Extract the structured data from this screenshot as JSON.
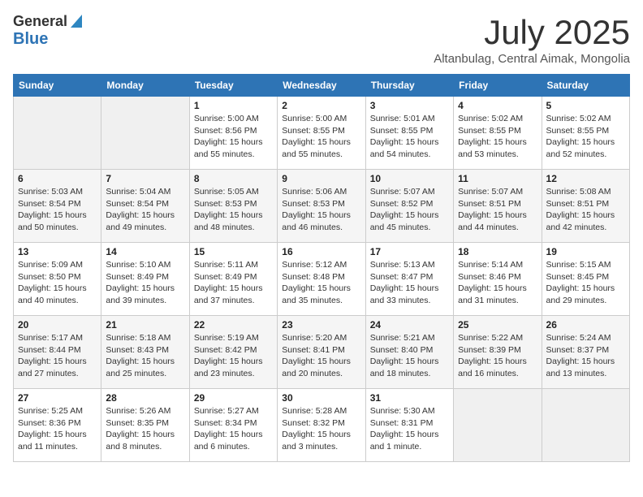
{
  "header": {
    "logo_general": "General",
    "logo_blue": "Blue",
    "month_title": "July 2025",
    "subtitle": "Altanbulag, Central Aimak, Mongolia"
  },
  "weekdays": [
    "Sunday",
    "Monday",
    "Tuesday",
    "Wednesday",
    "Thursday",
    "Friday",
    "Saturday"
  ],
  "weeks": [
    [
      {
        "day": "",
        "info": ""
      },
      {
        "day": "",
        "info": ""
      },
      {
        "day": "1",
        "info": "Sunrise: 5:00 AM\nSunset: 8:56 PM\nDaylight: 15 hours\nand 55 minutes."
      },
      {
        "day": "2",
        "info": "Sunrise: 5:00 AM\nSunset: 8:55 PM\nDaylight: 15 hours\nand 55 minutes."
      },
      {
        "day": "3",
        "info": "Sunrise: 5:01 AM\nSunset: 8:55 PM\nDaylight: 15 hours\nand 54 minutes."
      },
      {
        "day": "4",
        "info": "Sunrise: 5:02 AM\nSunset: 8:55 PM\nDaylight: 15 hours\nand 53 minutes."
      },
      {
        "day": "5",
        "info": "Sunrise: 5:02 AM\nSunset: 8:55 PM\nDaylight: 15 hours\nand 52 minutes."
      }
    ],
    [
      {
        "day": "6",
        "info": "Sunrise: 5:03 AM\nSunset: 8:54 PM\nDaylight: 15 hours\nand 50 minutes."
      },
      {
        "day": "7",
        "info": "Sunrise: 5:04 AM\nSunset: 8:54 PM\nDaylight: 15 hours\nand 49 minutes."
      },
      {
        "day": "8",
        "info": "Sunrise: 5:05 AM\nSunset: 8:53 PM\nDaylight: 15 hours\nand 48 minutes."
      },
      {
        "day": "9",
        "info": "Sunrise: 5:06 AM\nSunset: 8:53 PM\nDaylight: 15 hours\nand 46 minutes."
      },
      {
        "day": "10",
        "info": "Sunrise: 5:07 AM\nSunset: 8:52 PM\nDaylight: 15 hours\nand 45 minutes."
      },
      {
        "day": "11",
        "info": "Sunrise: 5:07 AM\nSunset: 8:51 PM\nDaylight: 15 hours\nand 44 minutes."
      },
      {
        "day": "12",
        "info": "Sunrise: 5:08 AM\nSunset: 8:51 PM\nDaylight: 15 hours\nand 42 minutes."
      }
    ],
    [
      {
        "day": "13",
        "info": "Sunrise: 5:09 AM\nSunset: 8:50 PM\nDaylight: 15 hours\nand 40 minutes."
      },
      {
        "day": "14",
        "info": "Sunrise: 5:10 AM\nSunset: 8:49 PM\nDaylight: 15 hours\nand 39 minutes."
      },
      {
        "day": "15",
        "info": "Sunrise: 5:11 AM\nSunset: 8:49 PM\nDaylight: 15 hours\nand 37 minutes."
      },
      {
        "day": "16",
        "info": "Sunrise: 5:12 AM\nSunset: 8:48 PM\nDaylight: 15 hours\nand 35 minutes."
      },
      {
        "day": "17",
        "info": "Sunrise: 5:13 AM\nSunset: 8:47 PM\nDaylight: 15 hours\nand 33 minutes."
      },
      {
        "day": "18",
        "info": "Sunrise: 5:14 AM\nSunset: 8:46 PM\nDaylight: 15 hours\nand 31 minutes."
      },
      {
        "day": "19",
        "info": "Sunrise: 5:15 AM\nSunset: 8:45 PM\nDaylight: 15 hours\nand 29 minutes."
      }
    ],
    [
      {
        "day": "20",
        "info": "Sunrise: 5:17 AM\nSunset: 8:44 PM\nDaylight: 15 hours\nand 27 minutes."
      },
      {
        "day": "21",
        "info": "Sunrise: 5:18 AM\nSunset: 8:43 PM\nDaylight: 15 hours\nand 25 minutes."
      },
      {
        "day": "22",
        "info": "Sunrise: 5:19 AM\nSunset: 8:42 PM\nDaylight: 15 hours\nand 23 minutes."
      },
      {
        "day": "23",
        "info": "Sunrise: 5:20 AM\nSunset: 8:41 PM\nDaylight: 15 hours\nand 20 minutes."
      },
      {
        "day": "24",
        "info": "Sunrise: 5:21 AM\nSunset: 8:40 PM\nDaylight: 15 hours\nand 18 minutes."
      },
      {
        "day": "25",
        "info": "Sunrise: 5:22 AM\nSunset: 8:39 PM\nDaylight: 15 hours\nand 16 minutes."
      },
      {
        "day": "26",
        "info": "Sunrise: 5:24 AM\nSunset: 8:37 PM\nDaylight: 15 hours\nand 13 minutes."
      }
    ],
    [
      {
        "day": "27",
        "info": "Sunrise: 5:25 AM\nSunset: 8:36 PM\nDaylight: 15 hours\nand 11 minutes."
      },
      {
        "day": "28",
        "info": "Sunrise: 5:26 AM\nSunset: 8:35 PM\nDaylight: 15 hours\nand 8 minutes."
      },
      {
        "day": "29",
        "info": "Sunrise: 5:27 AM\nSunset: 8:34 PM\nDaylight: 15 hours\nand 6 minutes."
      },
      {
        "day": "30",
        "info": "Sunrise: 5:28 AM\nSunset: 8:32 PM\nDaylight: 15 hours\nand 3 minutes."
      },
      {
        "day": "31",
        "info": "Sunrise: 5:30 AM\nSunset: 8:31 PM\nDaylight: 15 hours\nand 1 minute."
      },
      {
        "day": "",
        "info": ""
      },
      {
        "day": "",
        "info": ""
      }
    ]
  ]
}
